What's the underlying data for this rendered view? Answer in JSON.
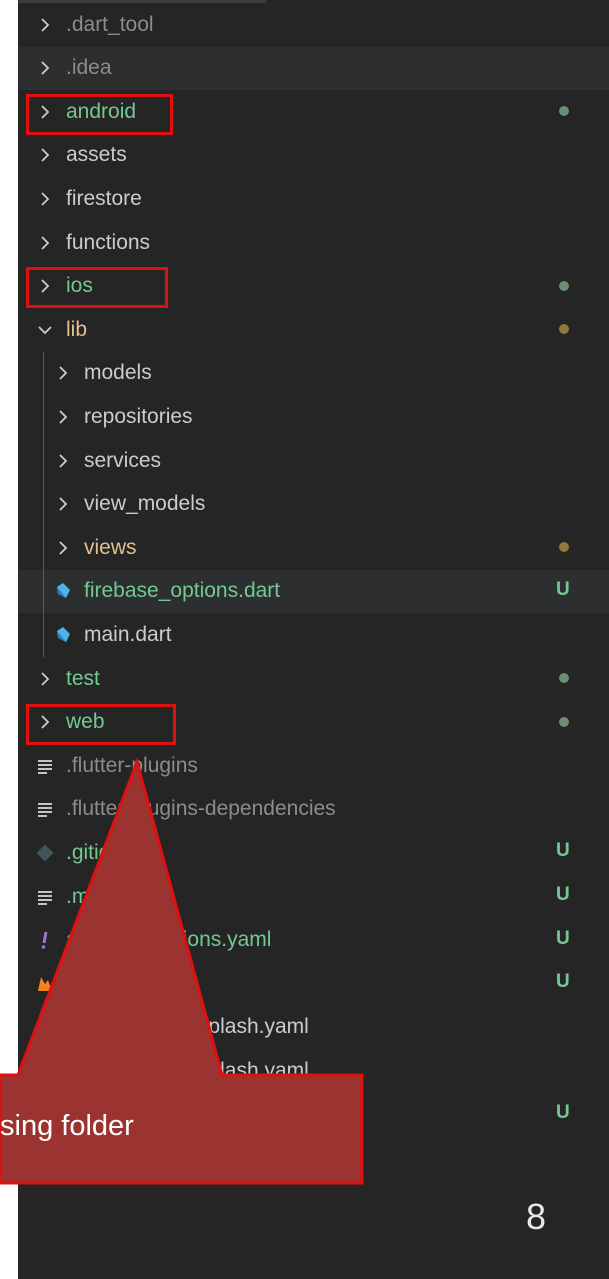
{
  "explorer": {
    "items": [
      {
        "label": ".dart_tool",
        "kind": "folder",
        "expanded": false,
        "color": "gray",
        "badge": ""
      },
      {
        "label": ".idea",
        "kind": "folder",
        "expanded": false,
        "color": "gray",
        "badge": ""
      },
      {
        "label": "android",
        "kind": "folder",
        "expanded": false,
        "color": "green",
        "badge": "dot"
      },
      {
        "label": "assets",
        "kind": "folder",
        "expanded": false,
        "color": "default",
        "badge": ""
      },
      {
        "label": "firestore",
        "kind": "folder",
        "expanded": false,
        "color": "default",
        "badge": ""
      },
      {
        "label": "functions",
        "kind": "folder",
        "expanded": false,
        "color": "default",
        "badge": ""
      },
      {
        "label": "ios",
        "kind": "folder",
        "expanded": false,
        "color": "green",
        "badge": "dot"
      },
      {
        "label": "lib",
        "kind": "folder",
        "expanded": true,
        "color": "yellow",
        "badge": "dot-yellow"
      },
      {
        "label": "models",
        "kind": "folder",
        "expanded": false,
        "color": "default",
        "badge": ""
      },
      {
        "label": "repositories",
        "kind": "folder",
        "expanded": false,
        "color": "default",
        "badge": ""
      },
      {
        "label": "services",
        "kind": "folder",
        "expanded": false,
        "color": "default",
        "badge": ""
      },
      {
        "label": "view_models",
        "kind": "folder",
        "expanded": false,
        "color": "default",
        "badge": ""
      },
      {
        "label": "views",
        "kind": "folder",
        "expanded": false,
        "color": "yellow",
        "badge": "dot-yellow"
      },
      {
        "label": "firebase_options.dart",
        "kind": "dart",
        "color": "green",
        "badge": "U"
      },
      {
        "label": "main.dart",
        "kind": "dart",
        "color": "default",
        "badge": ""
      },
      {
        "label": "test",
        "kind": "folder",
        "expanded": false,
        "color": "green",
        "badge": "dot"
      },
      {
        "label": "web",
        "kind": "folder",
        "expanded": false,
        "color": "green",
        "badge": "dot"
      },
      {
        "label": ".flutter-plugins",
        "kind": "text",
        "color": "gray",
        "badge": ""
      },
      {
        "label": ".flutter-plugins-dependencies",
        "kind": "text",
        "color": "gray",
        "badge": ""
      },
      {
        "label": ".gitignore",
        "kind": "git",
        "color": "green",
        "badge": "U"
      },
      {
        "label": ".metadata",
        "kind": "text",
        "color": "green",
        "badge": "U"
      },
      {
        "label": "analysis_options.yaml",
        "kind": "yaml-bang",
        "color": "green",
        "badge": "U"
      },
      {
        "label": "firebase.json",
        "kind": "json-firebase",
        "color": "green",
        "badge": "U"
      },
      {
        "label": "flutter_native_splash.yaml",
        "kind": "text",
        "color": "default",
        "badge": ""
      },
      {
        "label": "flutter_native_splash.yaml",
        "kind": "text",
        "color": "default",
        "badge": ""
      },
      {
        "label": "",
        "kind": "text",
        "color": "green",
        "badge": "U"
      }
    ],
    "badge_u_text": "U"
  },
  "callout": {
    "text": "sing folder",
    "fill": "#9b3430",
    "border": "#e01010"
  },
  "slide": {
    "page_number": "8"
  },
  "colors": {
    "panel_bg": "#252526",
    "selected_row": "#37373d",
    "git_green": "#73c991",
    "git_yellow": "#e2c08d",
    "highlight_red": "#e01010"
  }
}
